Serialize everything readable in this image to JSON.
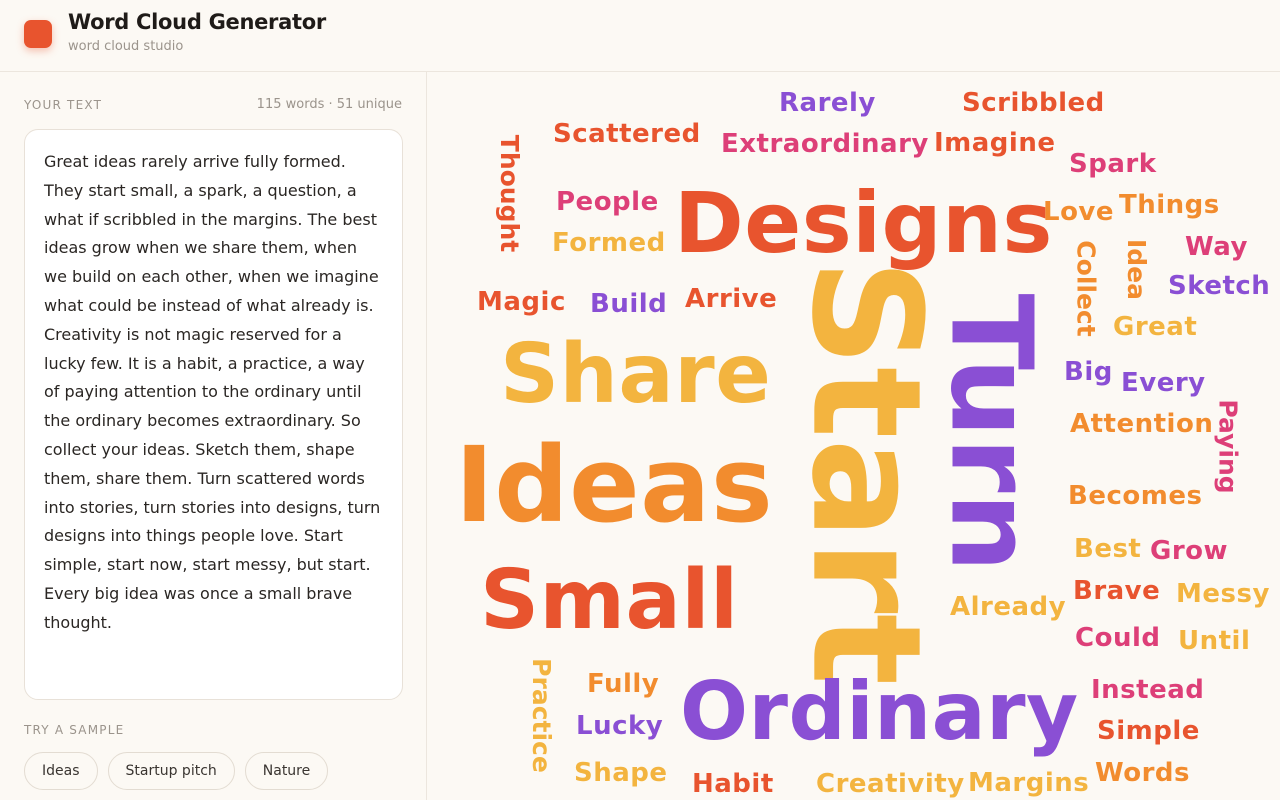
{
  "app": {
    "title": "Word Cloud Generator",
    "subtitle": "word cloud studio",
    "accent": "#e8542e"
  },
  "input_panel": {
    "label": "YOUR TEXT",
    "stats": "115 words · 51 unique",
    "text": "Great ideas rarely arrive fully formed. They start small, a spark, a question, a what if scribbled in the margins. The best ideas grow when we share them, when we build on each other, when we imagine what could be instead of what already is. Creativity is not magic reserved for a lucky few. It is a habit, a practice, a way of paying attention to the ordinary until the ordinary becomes extraordinary. So collect your ideas. Sketch them, shape them, share them. Turn scattered words into stories, turn stories into designs, turn designs into things people love. Start simple, start now, start messy, but start. Every big idea was once a small brave thought."
  },
  "samples": {
    "label": "TRY A SAMPLE",
    "items": [
      "Ideas",
      "Startup pitch",
      "Nature"
    ]
  },
  "palette": {
    "red": "#e8542e",
    "orange": "#f28c2e",
    "yellow": "#f3b43f",
    "pink": "#dd3f78",
    "purple": "#8a4fd4"
  },
  "cloud": {
    "words": [
      {
        "text": "Start",
        "color": "yellow",
        "rotated": true
      },
      {
        "text": "Ideas",
        "color": "orange",
        "rotated": false
      },
      {
        "text": "Turn",
        "color": "purple",
        "rotated": true
      },
      {
        "text": "Ordinary",
        "color": "purple",
        "rotated": false
      },
      {
        "text": "Designs",
        "color": "red",
        "rotated": false
      },
      {
        "text": "Share",
        "color": "yellow",
        "rotated": false
      },
      {
        "text": "Small",
        "color": "red",
        "rotated": false
      },
      {
        "text": "Rarely",
        "color": "purple",
        "rotated": false
      },
      {
        "text": "Scribbled",
        "color": "red",
        "rotated": false
      },
      {
        "text": "Scattered",
        "color": "red",
        "rotated": false
      },
      {
        "text": "Extraordinary",
        "color": "pink",
        "rotated": false
      },
      {
        "text": "Imagine",
        "color": "red",
        "rotated": false
      },
      {
        "text": "Spark",
        "color": "pink",
        "rotated": false
      },
      {
        "text": "Thought",
        "color": "red",
        "rotated": true
      },
      {
        "text": "People",
        "color": "pink",
        "rotated": false
      },
      {
        "text": "Formed",
        "color": "yellow",
        "rotated": false
      },
      {
        "text": "Love",
        "color": "orange",
        "rotated": false
      },
      {
        "text": "Things",
        "color": "orange",
        "rotated": false
      },
      {
        "text": "Way",
        "color": "pink",
        "rotated": false
      },
      {
        "text": "Collect",
        "color": "orange",
        "rotated": true
      },
      {
        "text": "Idea",
        "color": "orange",
        "rotated": true
      },
      {
        "text": "Sketch",
        "color": "purple",
        "rotated": false
      },
      {
        "text": "Magic",
        "color": "red",
        "rotated": false
      },
      {
        "text": "Build",
        "color": "purple",
        "rotated": false
      },
      {
        "text": "Arrive",
        "color": "red",
        "rotated": false
      },
      {
        "text": "Great",
        "color": "yellow",
        "rotated": false
      },
      {
        "text": "Big",
        "color": "purple",
        "rotated": false
      },
      {
        "text": "Every",
        "color": "purple",
        "rotated": false
      },
      {
        "text": "Paying",
        "color": "pink",
        "rotated": true
      },
      {
        "text": "Attention",
        "color": "orange",
        "rotated": false
      },
      {
        "text": "Becomes",
        "color": "orange",
        "rotated": false
      },
      {
        "text": "Best",
        "color": "yellow",
        "rotated": false
      },
      {
        "text": "Grow",
        "color": "pink",
        "rotated": false
      },
      {
        "text": "Brave",
        "color": "red",
        "rotated": false
      },
      {
        "text": "Messy",
        "color": "yellow",
        "rotated": false
      },
      {
        "text": "Already",
        "color": "yellow",
        "rotated": false
      },
      {
        "text": "Could",
        "color": "pink",
        "rotated": false
      },
      {
        "text": "Until",
        "color": "yellow",
        "rotated": false
      },
      {
        "text": "Practice",
        "color": "yellow",
        "rotated": true
      },
      {
        "text": "Fully",
        "color": "orange",
        "rotated": false
      },
      {
        "text": "Lucky",
        "color": "purple",
        "rotated": false
      },
      {
        "text": "Shape",
        "color": "yellow",
        "rotated": false
      },
      {
        "text": "Habit",
        "color": "red",
        "rotated": false
      },
      {
        "text": "Creativity",
        "color": "yellow",
        "rotated": false
      },
      {
        "text": "Margins",
        "color": "yellow",
        "rotated": false
      },
      {
        "text": "Instead",
        "color": "pink",
        "rotated": false
      },
      {
        "text": "Simple",
        "color": "red",
        "rotated": false
      },
      {
        "text": "Words",
        "color": "orange",
        "rotated": false
      }
    ]
  }
}
